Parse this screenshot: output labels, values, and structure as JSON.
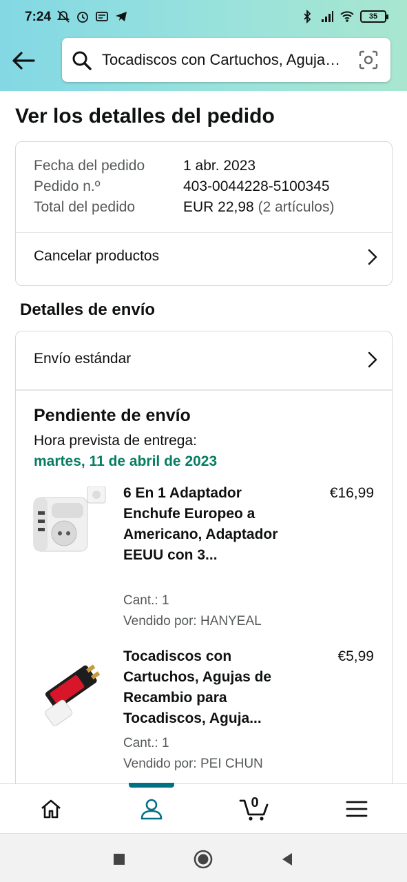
{
  "status_bar": {
    "time": "7:24",
    "battery": "35"
  },
  "search": {
    "query": "Tocadiscos con Cartuchos, Agujas de Recambio para Tocadiscos, Aguja..."
  },
  "page": {
    "title": "Ver los detalles del pedido"
  },
  "order_summary": {
    "date_label": "Fecha del pedido",
    "date_value": "1 abr. 2023",
    "number_label": "Pedido n.º",
    "number_value": "403-0044228-5100345",
    "total_label": "Total del pedido",
    "total_value": "EUR 22,98",
    "total_items": "(2 artículos)",
    "cancel_label": "Cancelar productos"
  },
  "shipping": {
    "section_title": "Detalles de envío",
    "method_label": "Envío estándar",
    "status_title": "Pendiente de envío",
    "delivery_label": "Hora prevista de entrega:",
    "delivery_date": "martes, 11 de abril de 2023"
  },
  "items": [
    {
      "name": "6 En 1 Adaptador Enchufe Europeo a Americano, Adaptador EEUU con 3...",
      "price": "€16,99",
      "qty": "Cant.: 1",
      "seller": "Vendido por: HANYEAL"
    },
    {
      "name": "Tocadiscos con Cartuchos, Agujas de Recambio para Tocadiscos, Aguja...",
      "price": "€5,99",
      "qty": "Cant.: 1",
      "seller": "Vendido por: PEI CHUN"
    }
  ],
  "tabbar": {
    "cart_count": "0",
    "active_tab": "account"
  },
  "colors": {
    "accent": "#007185",
    "delivery_green": "#067d62",
    "header_gradient_start": "#83d8e4",
    "header_gradient_end": "#a8e6cf"
  }
}
